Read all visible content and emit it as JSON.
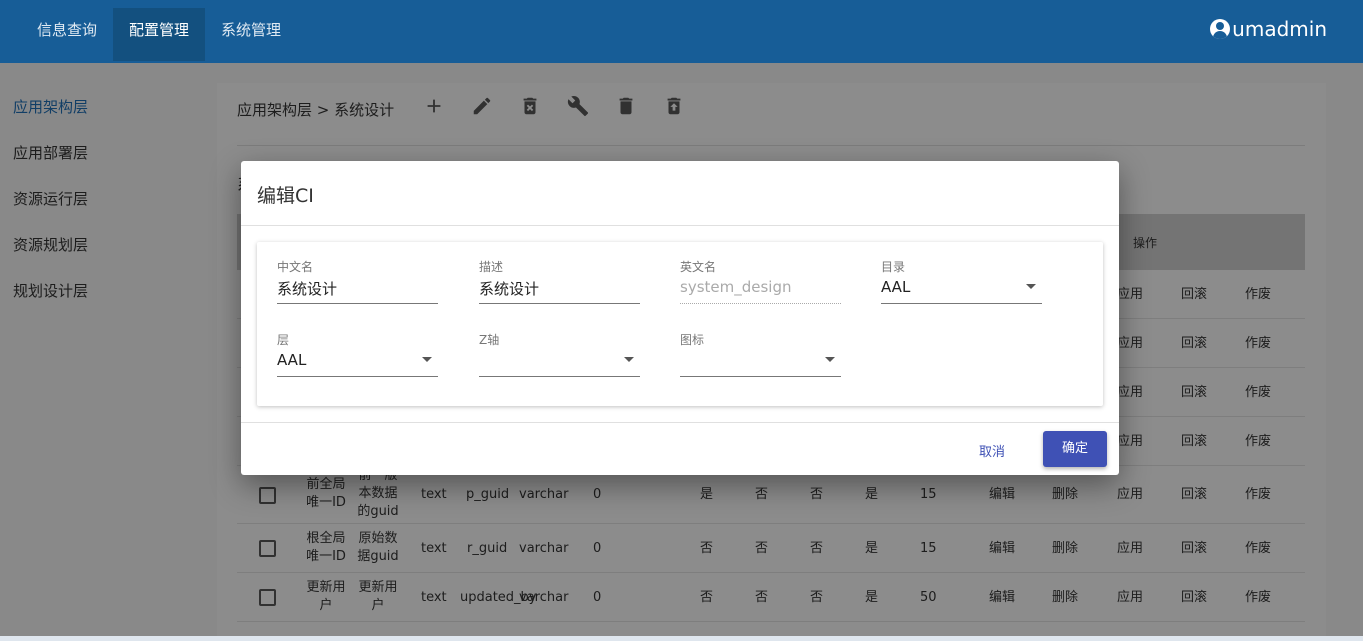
{
  "nav": {
    "items": [
      "信息查询",
      "配置管理",
      "系统管理"
    ],
    "active": "配置管理"
  },
  "user": {
    "name": "umadmin"
  },
  "sidebar": {
    "items": [
      "应用架构层",
      "应用部署层",
      "资源运行层",
      "资源规划层",
      "规划设计层"
    ],
    "active": "应用架构层"
  },
  "breadcrumb": "应用架构层 > 系统设计",
  "toolbar": [
    "add-icon",
    "edit-icon",
    "delete-x-icon",
    "wrench-icon",
    "trash-icon",
    "trash-restore-icon"
  ],
  "list_title_visible": "系",
  "table": {
    "ops_header": "操作",
    "row_actions": [
      "编辑",
      "删除",
      "应用",
      "回滚",
      "作废"
    ],
    "rows": [
      {
        "name": "前全局唯一ID",
        "desc": "前一版本数据的guid",
        "type": "text",
        "field": "p_guid",
        "dbtype": "varchar",
        "len": "0",
        "f1": "是",
        "f2": "否",
        "f3": "否",
        "f4": "是",
        "num": "15"
      },
      {
        "name": "根全局唯一ID",
        "desc": "原始数据guid",
        "type": "text",
        "field": "r_guid",
        "dbtype": "varchar",
        "len": "0",
        "f1": "否",
        "f2": "否",
        "f3": "否",
        "f4": "是",
        "num": "15"
      },
      {
        "name": "更新用户",
        "desc": "更新用户",
        "type": "text",
        "field": "updated_by",
        "dbtype": "varchar",
        "len": "0",
        "f1": "否",
        "f2": "否",
        "f3": "否",
        "f4": "是",
        "num": "50"
      }
    ]
  },
  "dialog": {
    "title": "编辑CI",
    "fields": {
      "cn_name": {
        "label": "中文名",
        "value": "系统设计"
      },
      "desc": {
        "label": "描述",
        "value": "系统设计"
      },
      "en_name": {
        "label": "英文名",
        "value": "system_design"
      },
      "catalog": {
        "label": "目录",
        "value": "AAL"
      },
      "layer": {
        "label": "层",
        "value": "AAL"
      },
      "z_axis": {
        "label": "Z轴",
        "value": ""
      },
      "icon": {
        "label": "图标",
        "value": ""
      }
    },
    "cancel_label": "取消",
    "ok_label": "确定"
  }
}
